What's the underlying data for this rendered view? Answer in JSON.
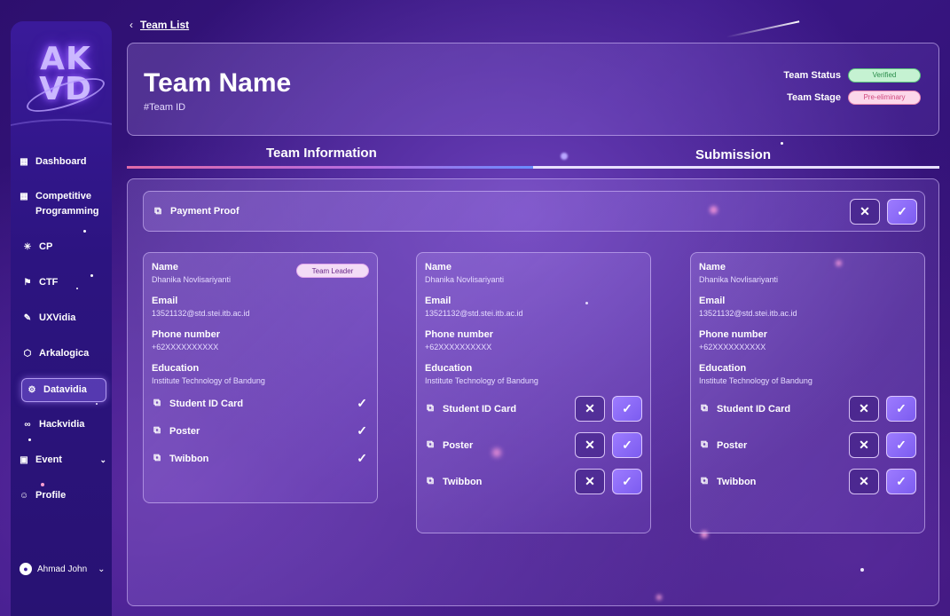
{
  "sidebar": {
    "logo_text": "AK VD",
    "items": [
      {
        "label": "Dashboard",
        "icon": "grid-icon"
      },
      {
        "label": "Competitive Programming",
        "icon": "grid-icon"
      },
      {
        "label": "CP",
        "icon": "sparkle-icon"
      },
      {
        "label": "CTF",
        "icon": "flag-icon"
      },
      {
        "label": "UXVidia",
        "icon": "pen-icon"
      },
      {
        "label": "Arkalogica",
        "icon": "cube-icon"
      },
      {
        "label": "Datavidia",
        "icon": "data-icon"
      },
      {
        "label": "Hackvidia",
        "icon": "infinity-icon"
      },
      {
        "label": "Event",
        "icon": "calendar-icon"
      },
      {
        "label": "Profile",
        "icon": "smile-icon"
      }
    ],
    "active_item": "Datavidia",
    "user_name": "Ahmad John"
  },
  "breadcrumb": {
    "label": "Team List"
  },
  "header": {
    "team_name": "Team Name",
    "team_id": "#Team ID",
    "status_label": "Team Status",
    "status_value": "Verified",
    "stage_label": "Team Stage",
    "stage_value": "Pre-eliminary"
  },
  "tabs": [
    {
      "label": "Team Information",
      "active": true
    },
    {
      "label": "Submission",
      "active": false
    }
  ],
  "payment": {
    "label": "Payment Proof"
  },
  "field_labels": {
    "name": "Name",
    "email": "Email",
    "phone": "Phone number",
    "education": "Education"
  },
  "leader_badge": "Team Leader",
  "members": [
    {
      "name": "Dhanika Novlisariyanti",
      "email": "13521132@std.stei.itb.ac.id",
      "phone": "+62XXXXXXXXXX",
      "education": "Institute Technology of Bandung",
      "is_leader": true,
      "documents": [
        {
          "label": "Student ID Card",
          "status": "verified"
        },
        {
          "label": "Poster",
          "status": "verified"
        },
        {
          "label": "Twibbon",
          "status": "verified"
        }
      ]
    },
    {
      "name": "Dhanika Novlisariyanti",
      "email": "13521132@std.stei.itb.ac.id",
      "phone": "+62XXXXXXXXXX",
      "education": "Institute Technology of Bandung",
      "is_leader": false,
      "documents": [
        {
          "label": "Student ID Card",
          "status": "pending"
        },
        {
          "label": "Poster",
          "status": "pending"
        },
        {
          "label": "Twibbon",
          "status": "pending"
        }
      ]
    },
    {
      "name": "Dhanika Novlisariyanti",
      "email": "13521132@std.stei.itb.ac.id",
      "phone": "+62XXXXXXXXXX",
      "education": "Institute Technology of Bandung",
      "is_leader": false,
      "documents": [
        {
          "label": "Student ID Card",
          "status": "pending"
        },
        {
          "label": "Poster",
          "status": "pending"
        },
        {
          "label": "Twibbon",
          "status": "pending"
        }
      ]
    }
  ],
  "colors": {
    "accent": "#8b6cf5",
    "verified_bg": "#c5f2d2",
    "stage_bg": "#fcd7ea",
    "tab_active_line": "#e06aa8"
  }
}
